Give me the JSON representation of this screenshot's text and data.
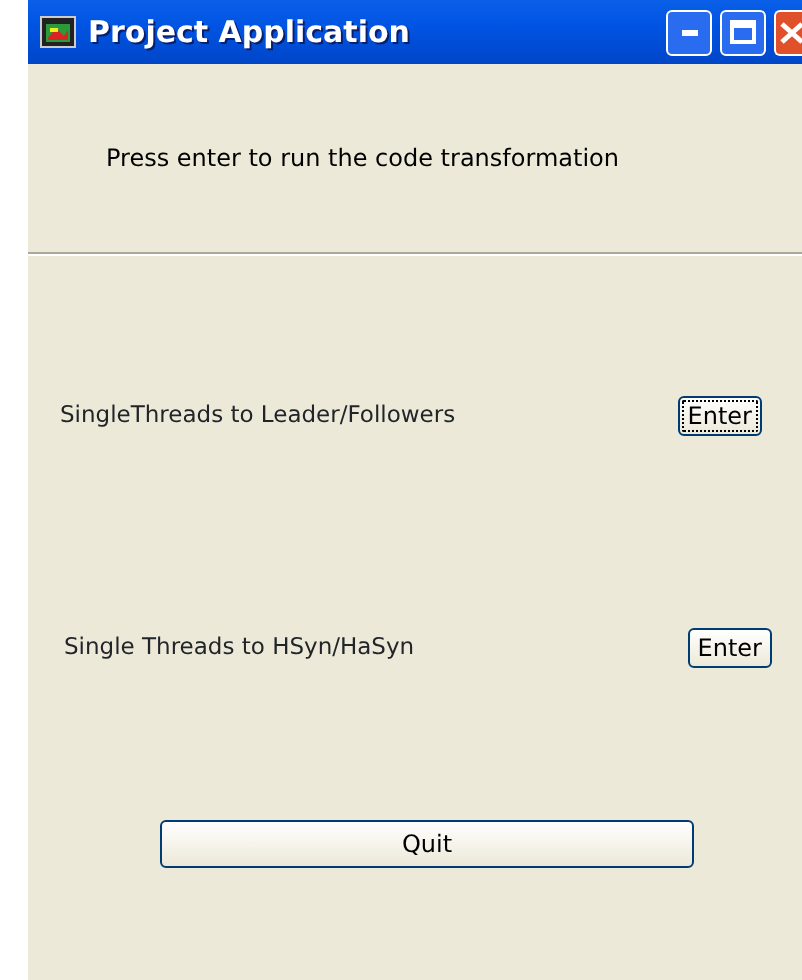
{
  "window": {
    "title": "Project Application"
  },
  "instruction": "Press enter to run the code transformation",
  "rows": [
    {
      "label": "SingleThreads to Leader/Followers",
      "button": "Enter",
      "focused": true
    },
    {
      "label": "Single Threads to HSyn/HaSyn",
      "button": "Enter",
      "focused": false
    }
  ],
  "quit_button": "Quit"
}
